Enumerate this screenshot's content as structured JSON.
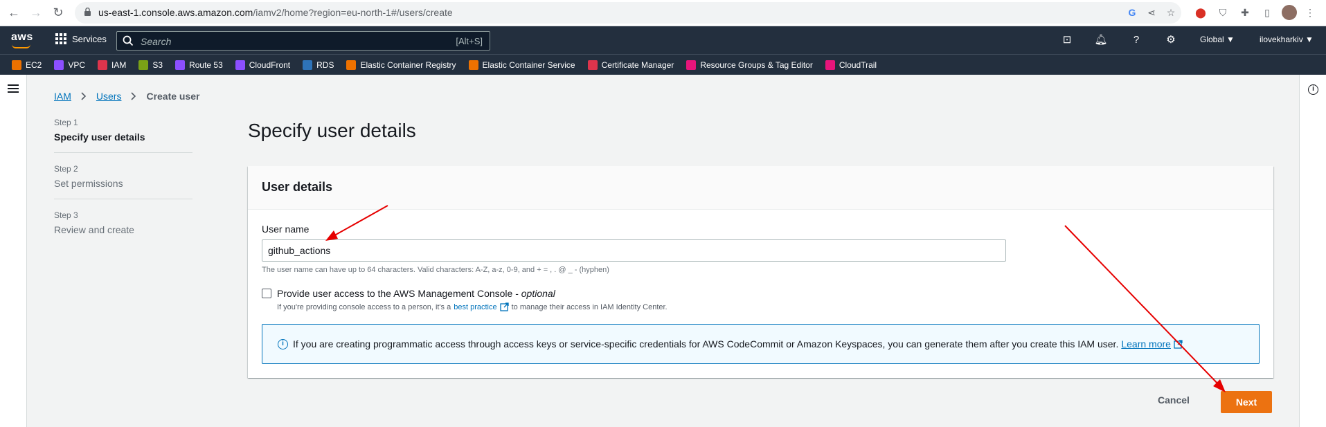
{
  "browser": {
    "url_host": "us-east-1.console.aws.amazon.com",
    "url_path": "/iamv2/home?region=eu-north-1#/users/create"
  },
  "aws_nav": {
    "logo": "aws",
    "services_label": "Services",
    "search_placeholder": "Search",
    "search_shortcut": "[Alt+S]",
    "region": "Global ▼",
    "account": "ilovekharkiv ▼"
  },
  "favorites": [
    {
      "label": "EC2",
      "color": "#ed7100"
    },
    {
      "label": "VPC",
      "color": "#8c4fff"
    },
    {
      "label": "IAM",
      "color": "#dd344c"
    },
    {
      "label": "S3",
      "color": "#7aa116"
    },
    {
      "label": "Route 53",
      "color": "#8c4fff"
    },
    {
      "label": "CloudFront",
      "color": "#8c4fff"
    },
    {
      "label": "RDS",
      "color": "#2e73b8"
    },
    {
      "label": "Elastic Container Registry",
      "color": "#ed7100"
    },
    {
      "label": "Elastic Container Service",
      "color": "#ed7100"
    },
    {
      "label": "Certificate Manager",
      "color": "#dd344c"
    },
    {
      "label": "Resource Groups & Tag Editor",
      "color": "#e7157b"
    },
    {
      "label": "CloudTrail",
      "color": "#e7157b"
    }
  ],
  "breadcrumb": {
    "iam": "IAM",
    "users": "Users",
    "current": "Create user"
  },
  "steps": [
    {
      "num": "Step 1",
      "label": "Specify user details"
    },
    {
      "num": "Step 2",
      "label": "Set permissions"
    },
    {
      "num": "Step 3",
      "label": "Review and create"
    }
  ],
  "page_title": "Specify user details",
  "user_details": {
    "header": "User details",
    "user_name_label": "User name",
    "user_name_value": "github_actions",
    "user_name_hint": "The user name can have up to 64 characters. Valid characters: A-Z, a-z, 0-9, and + = , . @ _ - (hyphen)",
    "console_access_label": "Provide user access to the AWS Management Console - ",
    "console_access_optional": "optional",
    "console_access_desc_before": "If you're providing console access to a person, it's a",
    "console_access_link": "best practice",
    "console_access_desc_after": "to manage their access in IAM Identity Center.",
    "info_message": "If you are creating programmatic access through access keys or service-specific credentials for AWS CodeCommit or Amazon Keyspaces, you can generate them after you create this IAM user.",
    "info_link": "Learn more"
  },
  "actions": {
    "cancel": "Cancel",
    "next": "Next"
  },
  "colors": {
    "nav_bg": "#232f3e",
    "primary": "#ec7211",
    "link": "#0073bb",
    "annotation_arrow": "#e60000"
  }
}
